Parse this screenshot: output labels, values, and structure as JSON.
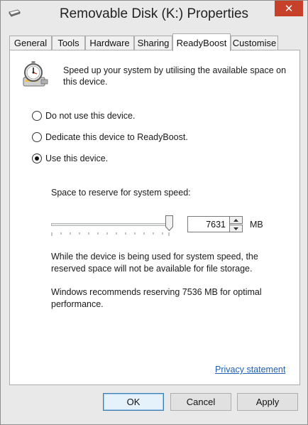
{
  "window": {
    "title": "Removable Disk (K:) Properties",
    "close_glyph": "✕",
    "accent_close": "#c7402a"
  },
  "tabs": [
    {
      "label": "General",
      "active": false
    },
    {
      "label": "Tools",
      "active": false
    },
    {
      "label": "Hardware",
      "active": false
    },
    {
      "label": "Sharing",
      "active": false
    },
    {
      "label": "ReadyBoost",
      "active": true
    },
    {
      "label": "Customise",
      "active": false
    }
  ],
  "readyboost": {
    "icon": "readyboost-stopwatch-icon",
    "intro": "Speed up your system by utilising the available space on this device.",
    "options": [
      {
        "label": "Do not use this device.",
        "checked": false
      },
      {
        "label": "Dedicate this device to ReadyBoost.",
        "checked": false
      },
      {
        "label": "Use this device.",
        "checked": true
      }
    ],
    "reserve_label": "Space to reserve for system speed:",
    "reserve_value": "7631",
    "slider_level": 1.0,
    "unit": "MB",
    "info_text": "While the device is being used for system speed, the reserved space will not be available for file storage.",
    "recommend_text": "Windows recommends reserving 7536 MB for optimal performance.",
    "privacy_link": "Privacy statement"
  },
  "buttons": {
    "ok": "OK",
    "cancel": "Cancel",
    "apply": "Apply"
  }
}
